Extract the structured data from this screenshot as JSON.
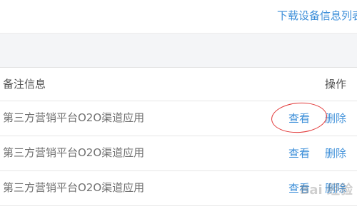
{
  "top_link": "下载设备信息列表",
  "table": {
    "col_remark": "备注信息",
    "col_op": "操作",
    "rows": [
      {
        "remark": "第三方营销平台O2O渠道应用",
        "view": "查看",
        "delete": "删除"
      },
      {
        "remark": "第三方营销平台O2O渠道应用",
        "view": "查看",
        "delete": "删除"
      },
      {
        "remark": "第三方营销平台O2O渠道应用",
        "view": "查看",
        "delete": "删除"
      }
    ]
  },
  "watermark": "Bai 经验"
}
